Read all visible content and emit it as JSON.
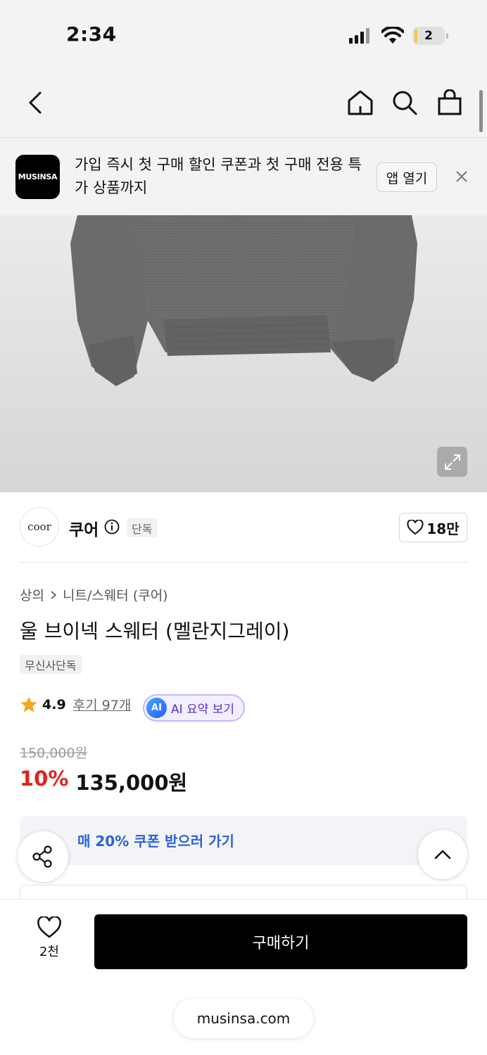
{
  "status": {
    "time": "2:34",
    "battery": "2"
  },
  "nav": {
    "back": "back-icon",
    "home": "home-icon",
    "search": "search-icon",
    "cart": "bag-icon"
  },
  "banner": {
    "logo": "MUSINSA",
    "text": "가입 즉시 첫 구매 할인 쿠폰과 첫 구매 전용 특가 상품까지",
    "open_app": "앱 열기"
  },
  "brand": {
    "logo": "coor",
    "name": "쿠어",
    "badge": "단독",
    "likes": "18만"
  },
  "breadcrumb": {
    "category": "상의",
    "subcategory": "니트/스웨터 (쿠어)"
  },
  "product": {
    "title": "울 브이넥 스웨터 (멜란지그레이)",
    "tag": "무신사단독",
    "rating": "4.9",
    "reviews": "후기 97개",
    "ai_icon": "AI",
    "ai_summary": "AI 요약 보기",
    "original_price": "150,000원",
    "discount": "10%",
    "price": "135,000원",
    "coupon": "매 20% 쿠폰 받으러 가기"
  },
  "bottom": {
    "wish_count": "2천",
    "buy": "구매하기",
    "url": "musinsa.com"
  },
  "colors": {
    "accent_red": "#e0231b",
    "coupon_blue": "#2a63d8",
    "ai_purple": "#5a2fd0",
    "star": "#f5a623"
  }
}
